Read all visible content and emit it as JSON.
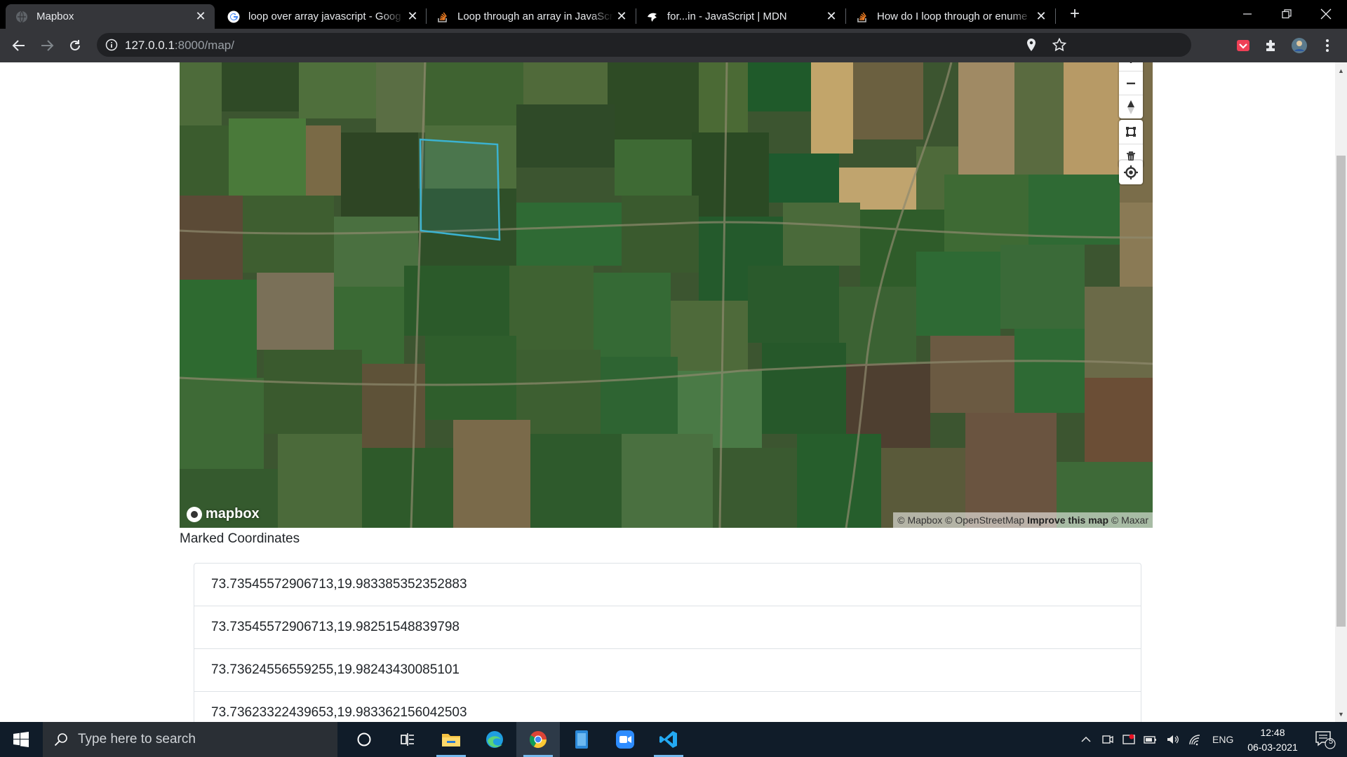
{
  "browser": {
    "tabs": [
      {
        "title": "Mapbox",
        "icon": "globe-icon",
        "active": true
      },
      {
        "title": "loop over array javascript - Goog",
        "icon": "google-icon",
        "active": false
      },
      {
        "title": "Loop through an array in JavaScr",
        "icon": "stackoverflow-icon",
        "active": false
      },
      {
        "title": "for...in - JavaScript | MDN",
        "icon": "mdn-icon",
        "active": false
      },
      {
        "title": "How do I loop through or enume",
        "icon": "stackoverflow-icon",
        "active": false
      }
    ],
    "new_tab_label": "+",
    "close_label": "✕",
    "url_host": "127.0.0.1",
    "url_rest": ":8000/map/"
  },
  "map": {
    "logo_text": "mapbox",
    "attribution": {
      "mapbox": "© Mapbox",
      "osm": "© OpenStreetMap",
      "improve": "Improve this map",
      "maxar": "© Maxar"
    },
    "controls": [
      "zoom-in-icon",
      "zoom-out-icon",
      "compass-icon",
      "polygon-draw-icon",
      "trash-icon",
      "geolocate-icon"
    ]
  },
  "coordinates": {
    "title": "Marked Coordinates",
    "items": [
      "73.73545572906713,19.983385352352883",
      "73.73545572906713,19.98251548839798",
      "73.73624556559255,19.98243430085101",
      "73.73623322439653,19.983362156042503"
    ]
  },
  "taskbar": {
    "search_placeholder": "Type here to search",
    "language": "ENG",
    "time": "12:48",
    "date": "06-03-2021",
    "notification_count": "5"
  },
  "colors": {
    "tab_bg": "#000000",
    "toolbar_bg": "#35363a",
    "polygon_stroke": "#3bb2d0",
    "taskbar_bg": "#101c29"
  }
}
